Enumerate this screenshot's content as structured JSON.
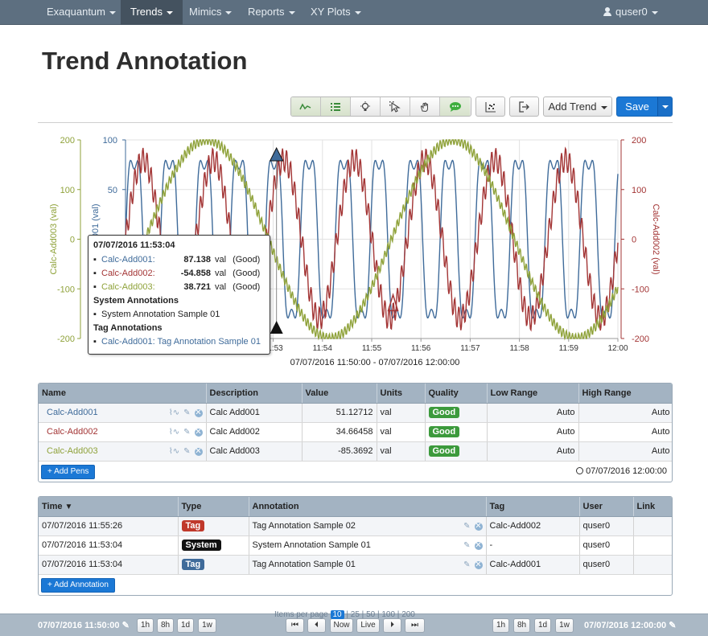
{
  "nav": {
    "items": [
      "Exaquantum",
      "Trends",
      "Mimics",
      "Reports",
      "XY Plots"
    ],
    "user": "quser0"
  },
  "page_title": "Trend Annotation",
  "toolbar": {
    "add_trend": "Add Trend",
    "save": "Save"
  },
  "chart_data": {
    "type": "line",
    "x_ticks": [
      "11:53",
      "11:54",
      "11:55",
      "11:56",
      "11:57",
      "11:58",
      "11:59",
      "12:00"
    ],
    "x_range_label": "07/07/2016 11:50:00 - 07/07/2016 12:00:00",
    "y_left_outer": {
      "label": "Calc-Add003 (val)",
      "ticks": [
        200,
        100,
        0,
        -100,
        -200
      ],
      "color": "#8fa23a"
    },
    "y_left_inner": {
      "label": "Calc-Add001 (val)",
      "ticks": [
        100,
        50
      ],
      "color": "#3f6b9a"
    },
    "y_right": {
      "label": "Calc-Add002 (val)",
      "ticks": [
        200,
        100,
        0,
        -100,
        -200
      ],
      "color": "#a33535"
    },
    "series": [
      {
        "name": "Calc-Add001",
        "color": "#3f6b9a",
        "period_minutes": 0.71,
        "amplitude_range": [
          -100,
          100
        ]
      },
      {
        "name": "Calc-Add002",
        "color": "#a33535",
        "period_minutes": 1.43,
        "amplitude_range": [
          -100,
          100
        ]
      },
      {
        "name": "Calc-Add003",
        "color": "#8fa23a",
        "period_minutes": 5.0,
        "amplitude_range": [
          -100,
          100
        ]
      }
    ],
    "annotation_markers": [
      {
        "time": "11:53:04",
        "type": "System"
      },
      {
        "time": "11:55:26",
        "type": "Tag"
      }
    ]
  },
  "tooltip": {
    "time": "07/07/2016 11:53:04",
    "rows": [
      {
        "name": "Calc-Add001:",
        "value": "87.138",
        "unit": "val",
        "quality": "(Good)",
        "color": "#3f6b9a"
      },
      {
        "name": "Calc-Add002:",
        "value": "-54.858",
        "unit": "val",
        "quality": "(Good)",
        "color": "#a33535"
      },
      {
        "name": "Calc-Add003:",
        "value": "38.721",
        "unit": "val",
        "quality": "(Good)",
        "color": "#8fa23a"
      }
    ],
    "system_heading": "System Annotations",
    "system_item": "System Annotation Sample 01",
    "tag_heading": "Tag Annotations",
    "tag_item": "Calc-Add001: Tag Annotation Sample 01"
  },
  "pens": {
    "headers": [
      "Name",
      "Description",
      "Value",
      "Units",
      "Quality",
      "Low Range",
      "High Range"
    ],
    "rows": [
      {
        "name": "Calc-Add001",
        "color": "#3f6b9a",
        "description": "Calc Add001",
        "value": "51.12712",
        "units": "val",
        "quality": "Good",
        "low": "Auto",
        "high": "Auto"
      },
      {
        "name": "Calc-Add002",
        "color": "#a33535",
        "description": "Calc Add002",
        "value": "34.66458",
        "units": "val",
        "quality": "Good",
        "low": "Auto",
        "high": "Auto"
      },
      {
        "name": "Calc-Add003",
        "color": "#8fa23a",
        "description": "Calc Add003",
        "value": "-85.3692",
        "units": "val",
        "quality": "Good",
        "low": "Auto",
        "high": "Auto"
      }
    ],
    "add_button": "+ Add Pens",
    "timestamp": "07/07/2016 12:00:00"
  },
  "annotations": {
    "headers": [
      "Time",
      "Type",
      "Annotation",
      "Tag",
      "User",
      "Link"
    ],
    "rows": [
      {
        "time": "07/07/2016 11:55:26",
        "type": "Tag",
        "type_color": "#c0392b",
        "annotation": "Tag Annotation Sample 02",
        "tag": "Calc-Add002",
        "user": "quser0",
        "link": ""
      },
      {
        "time": "07/07/2016 11:53:04",
        "type": "System",
        "type_color": "#111111",
        "annotation": "System Annotation Sample 01",
        "tag": "-",
        "user": "quser0",
        "link": ""
      },
      {
        "time": "07/07/2016 11:53:04",
        "type": "Tag",
        "type_color": "#3f6b9a",
        "annotation": "Tag Annotation Sample 01",
        "tag": "Calc-Add001",
        "user": "quser0",
        "link": ""
      }
    ],
    "add_button": "+ Add Annotation"
  },
  "pagination": {
    "label": "Items per page",
    "options": [
      "10",
      "25",
      "50",
      "100",
      "200"
    ],
    "selected": "10"
  },
  "bottom": {
    "start_time": "07/07/2016 11:50:00",
    "end_time": "07/07/2016 12:00:00",
    "ranges": [
      "1h",
      "8h",
      "1d",
      "1w"
    ],
    "nav_now": "Now",
    "nav_live": "Live"
  }
}
